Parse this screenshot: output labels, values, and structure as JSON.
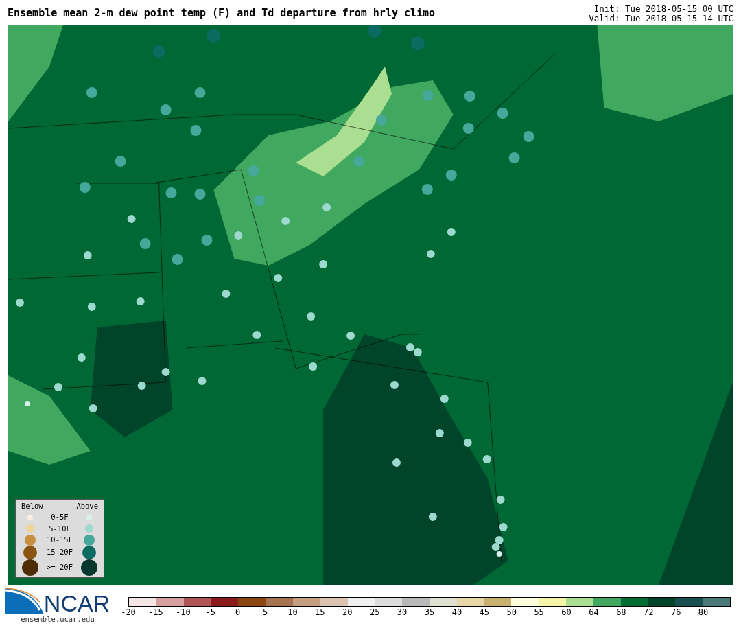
{
  "title": "Ensemble mean 2-m dew point temp (F) and Td departure from hrly climo",
  "run_info": {
    "init": "Init: Tue 2018-05-15 00 UTC",
    "valid": "Valid: Tue 2018-05-15 14 UTC"
  },
  "legend": {
    "below_heading": "Below",
    "above_heading": "Above",
    "rows": [
      {
        "label": "0-5F",
        "below": {
          "color": "#fbf0e0"
        },
        "above": {
          "color": "#d8f0ec"
        }
      },
      {
        "label": "5-10F",
        "below": {
          "color": "#ecd49a"
        },
        "above": {
          "color": "#9dd9cf"
        }
      },
      {
        "label": "10-15F",
        "below": {
          "color": "#c88f40"
        },
        "above": {
          "color": "#46a89b"
        }
      },
      {
        "label": "15-20F",
        "below": {
          "color": "#8b5411"
        },
        "above": {
          "color": "#0b6a62"
        }
      },
      {
        "label": ">= 20F",
        "below": {
          "color": "#4e2d06"
        },
        "above": {
          "color": "#04382e"
        }
      }
    ]
  },
  "logo": {
    "text": "NCAR",
    "url": "ensemble.ucar.edu"
  },
  "colorbar": {
    "segments": [
      {
        "color": "#f5e6e6"
      },
      {
        "color": "#d4a0a0"
      },
      {
        "color": "#b05555"
      },
      {
        "color": "#8b1a1a"
      },
      {
        "color": "#8b4513"
      },
      {
        "color": "#a67350"
      },
      {
        "color": "#c4a080"
      },
      {
        "color": "#dcc3b0"
      },
      {
        "color": "#f0f0f0"
      },
      {
        "color": "#dcdcdc"
      },
      {
        "color": "#b8b8b8"
      },
      {
        "color": "#e0e0d0"
      },
      {
        "color": "#e6d6a8"
      },
      {
        "color": "#c9b070"
      },
      {
        "color": "#ffffdd"
      },
      {
        "color": "#f5f5a8"
      },
      {
        "color": "#aade90"
      },
      {
        "color": "#41a85f"
      },
      {
        "color": "#006d35"
      },
      {
        "color": "#00442a"
      },
      {
        "color": "#1a4f4f"
      },
      {
        "color": "#4a7878"
      }
    ],
    "ticks": [
      "-20",
      "-15",
      "-10",
      "-5",
      "0",
      "5",
      "10",
      "15",
      "20",
      "25",
      "30",
      "35",
      "40",
      "45",
      "50",
      "55",
      "60",
      "64",
      "68",
      "72",
      "76",
      "80"
    ]
  }
}
